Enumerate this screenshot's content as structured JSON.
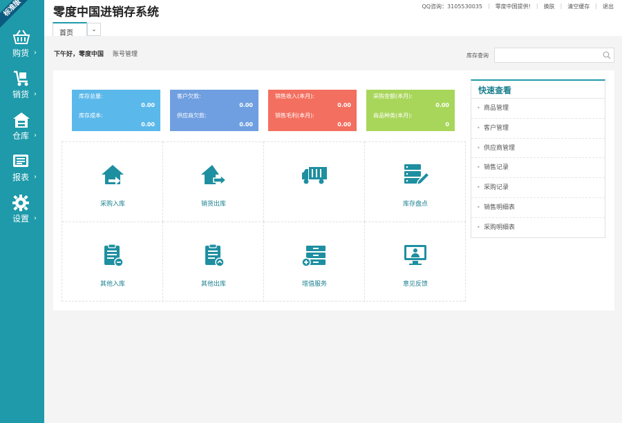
{
  "badge": "标准版",
  "sidebar": {
    "items": [
      {
        "label": "购货",
        "icon": "basket-icon"
      },
      {
        "label": "销货",
        "icon": "cart-icon"
      },
      {
        "label": "仓库",
        "icon": "warehouse-icon"
      },
      {
        "label": "报表",
        "icon": "report-icon"
      },
      {
        "label": "设置",
        "icon": "gear-icon"
      }
    ],
    "chevron": "›"
  },
  "header": {
    "title": "零度中国进销存系统",
    "links": [
      "QQ咨询：3105530035",
      "零度中国提供!",
      "换肤",
      "清空缓存",
      "退出"
    ],
    "tab": "首页",
    "tab_more": "⌄"
  },
  "greeting": {
    "text": "下午好，零度中国",
    "account": "账号管理"
  },
  "search": {
    "label": "库存查询",
    "value": "",
    "placeholder": ""
  },
  "stats": [
    {
      "label1": "库存总量:",
      "value1": "0.00",
      "label2": "库存成本:",
      "value2": "0.00",
      "color": "#5bb8ea"
    },
    {
      "label1": "客户欠款:",
      "value1": "0.00",
      "label2": "供应商欠款:",
      "value2": "0.00",
      "color": "#6f9fe0"
    },
    {
      "label1": "销售收入(本月):",
      "value1": "0.00",
      "label2": "销售毛利(本月):",
      "value2": "0.00",
      "color": "#f36f5f"
    },
    {
      "label1": "采购金额(本月):",
      "value1": "0.00",
      "label2": "商品种类(本月):",
      "value2": "0",
      "color": "#a8d65a"
    }
  ],
  "tiles": [
    {
      "label": "采购入库",
      "icon": "house-in-icon"
    },
    {
      "label": "销货出库",
      "icon": "house-out-icon"
    },
    {
      "label": "",
      "icon": "truck-icon"
    },
    {
      "label": "库存盘点",
      "icon": "stack-edit-icon"
    },
    {
      "label": "其他入库",
      "icon": "clipboard-in-icon"
    },
    {
      "label": "其他出库",
      "icon": "clipboard-out-icon"
    },
    {
      "label": "增值服务",
      "icon": "cabinet-plus-icon"
    },
    {
      "label": "意见反馈",
      "icon": "monitor-user-icon"
    }
  ],
  "quick": {
    "title": "快速查看",
    "items": [
      "商品管理",
      "客户管理",
      "供应商管理",
      "销售记录",
      "采购记录",
      "销售明细表",
      "采购明细表"
    ]
  },
  "colors": {
    "sidebar": "#1e9aaa",
    "accent": "#1a7f8e"
  }
}
